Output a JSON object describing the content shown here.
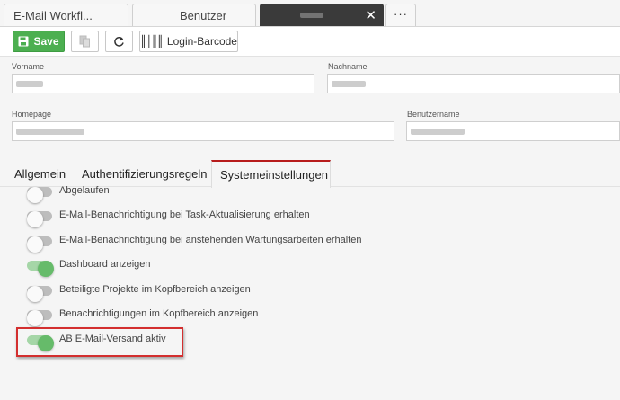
{
  "window_tabs": [
    {
      "label": "E-Mail Workfl..."
    },
    {
      "label": "Benutzer"
    },
    {
      "label": "",
      "close": "✕"
    }
  ],
  "more_tab": "···",
  "toolbar": {
    "save_label": "Save",
    "barcode_label": "Login-Barcode"
  },
  "form": {
    "vorname_label": "Vorname",
    "nachname_label": "Nachname",
    "homepage_label": "Homepage",
    "benutzername_label": "Benutzername"
  },
  "section_tabs": [
    "Allgemein",
    "Authentifizierungsregeln",
    "Systemeinstellungen"
  ],
  "toggles": [
    {
      "label": "Abgelaufen",
      "on": false
    },
    {
      "label": "E-Mail-Benachrichtigung bei Task-Aktualisierung erhalten",
      "on": false
    },
    {
      "label": "E-Mail-Benachrichtigung bei anstehenden Wartungsarbeiten erhalten",
      "on": false
    },
    {
      "label": "Dashboard anzeigen",
      "on": true
    },
    {
      "label": "Beteiligte Projekte im Kopfbereich anzeigen",
      "on": false
    },
    {
      "label": "Benachrichtigungen im Kopfbereich anzeigen",
      "on": false
    },
    {
      "label": "AB E-Mail-Versand aktiv",
      "on": true
    }
  ],
  "colors": {
    "accent_green": "#4caf50",
    "active_tab_dark": "#3a3a3a",
    "active_section_border": "#b71c1c",
    "highlight_red": "#d32f2f"
  }
}
